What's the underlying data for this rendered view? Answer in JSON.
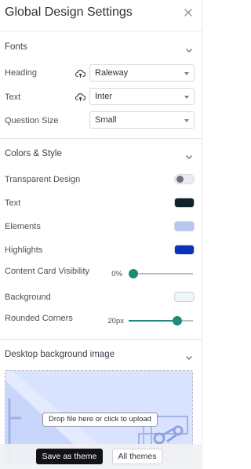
{
  "header": {
    "title": "Global Design Settings",
    "close_icon": "close-icon"
  },
  "fonts": {
    "title": "Fonts",
    "heading_label": "Heading",
    "heading_value": "Raleway",
    "text_label": "Text",
    "text_value": "Inter",
    "question_size_label": "Question Size",
    "question_size_value": "Small"
  },
  "colors_style": {
    "title": "Colors & Style",
    "transparent_label": "Transparent Design",
    "transparent_on": false,
    "text_label": "Text",
    "text_color": "#0d2229",
    "elements_label": "Elements",
    "elements_color": "#b7c7f1",
    "highlights_label": "Highlights",
    "highlights_color": "#0a33b8",
    "content_card_label": "Content Card Visibility",
    "content_card_value": "0%",
    "content_card_fraction": 0,
    "background_label": "Background",
    "background_color": "#eef6f8",
    "rounded_label": "Rounded Corners",
    "rounded_value": "20px",
    "rounded_fraction": 0.76
  },
  "desktop_bg": {
    "title": "Desktop background image",
    "dropzone_text": "Drop file here or click to upload"
  },
  "footer": {
    "save_label": "Save as theme",
    "themes_label": "All themes"
  },
  "colors": {
    "accent": "#1e8a7a",
    "primary_button": "#111318"
  }
}
